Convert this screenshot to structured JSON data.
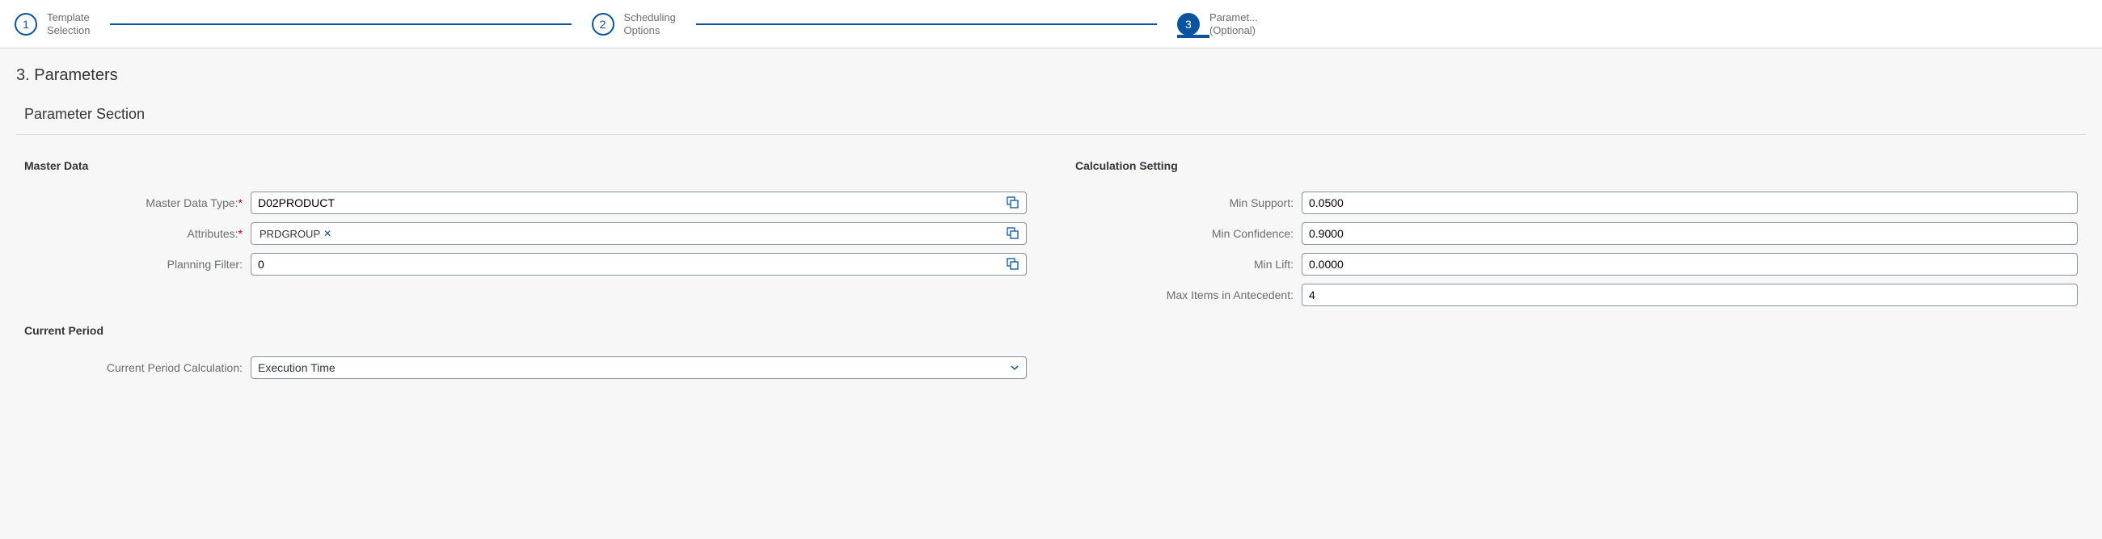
{
  "wizard": {
    "steps": [
      {
        "num": "1",
        "label": "Template\nSelection"
      },
      {
        "num": "2",
        "label": "Scheduling\nOptions"
      },
      {
        "num": "3",
        "label": "Paramet...\n(Optional)"
      }
    ]
  },
  "page": {
    "title": "3. Parameters",
    "section": "Parameter Section"
  },
  "masterData": {
    "groupTitle": "Master Data",
    "masterDataTypeLabel": "Master Data Type:",
    "masterDataTypeValue": "D02PRODUCT",
    "attributesLabel": "Attributes:",
    "attributesToken": "PRDGROUP",
    "planningFilterLabel": "Planning Filter:",
    "planningFilterValue": "0"
  },
  "calc": {
    "groupTitle": "Calculation Setting",
    "minSupportLabel": "Min Support:",
    "minSupportValue": "0.0500",
    "minConfidenceLabel": "Min Confidence:",
    "minConfidenceValue": "0.9000",
    "minLiftLabel": "Min Lift:",
    "minLiftValue": "0.0000",
    "maxItemsLabel": "Max Items in Antecedent:",
    "maxItemsValue": "4"
  },
  "currentPeriod": {
    "groupTitle": "Current Period",
    "calcLabel": "Current Period Calculation:",
    "calcValue": "Execution Time"
  }
}
